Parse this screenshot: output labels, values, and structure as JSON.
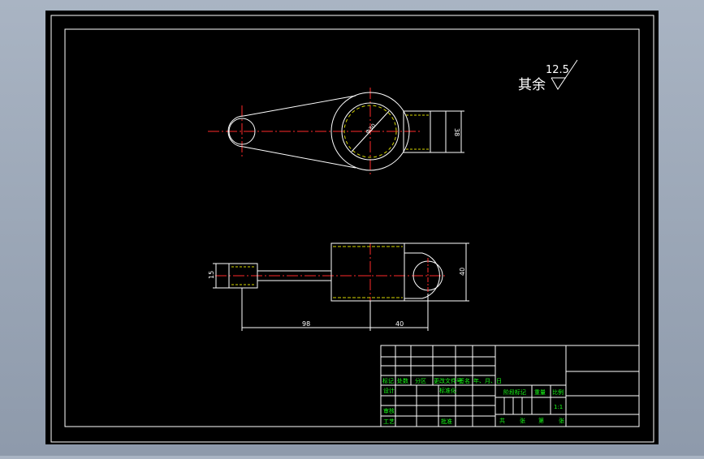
{
  "drawing": {
    "roughness_prefix": "其余",
    "roughness_value": "12.5",
    "top_view": {
      "bore_label": "Φ30",
      "height_label": "38"
    },
    "front_view": {
      "left_height": "15",
      "right_height": "40",
      "length_main": "98",
      "length_right": "40"
    }
  },
  "title_block": {
    "labels": {
      "mark": "标记",
      "count": "处数",
      "zone": "分区",
      "doc_no": "更改文件号",
      "sign": "签名",
      "date": "年、月、日",
      "design": "设计",
      "standardize": "标准化",
      "review": "审核",
      "process": "工艺",
      "approve": "批准",
      "stage_mark": "阶段标记",
      "weight": "重量",
      "scale": "比例",
      "total": "共",
      "sheets": "张",
      "page": "第",
      "sheet": "张"
    },
    "scale_value": "1:1"
  },
  "colors": {
    "background": "#000000",
    "line": "#ffffff",
    "center": "#ff2a2a",
    "hatch": "#d6d600",
    "text_green": "#19ff19"
  }
}
